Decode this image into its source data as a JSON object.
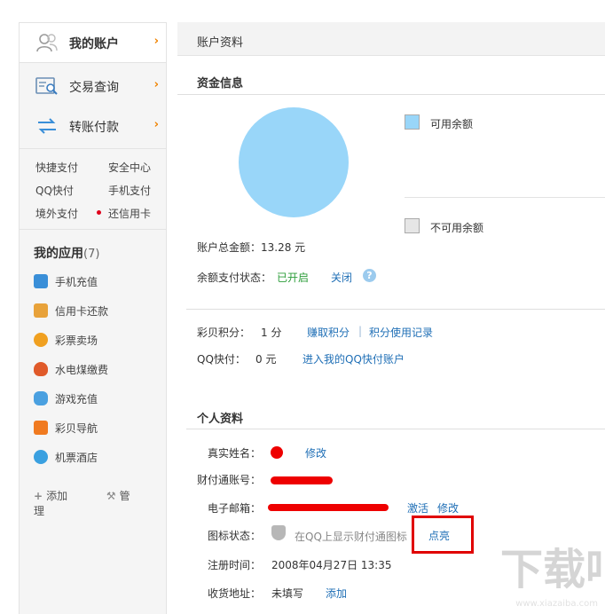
{
  "sidebar": {
    "nav": [
      {
        "label": "我的账户",
        "icon": "user-icon",
        "active": true
      },
      {
        "label": "交易查询",
        "icon": "search-list-icon",
        "active": false
      },
      {
        "label": "转账付款",
        "icon": "transfer-icon",
        "active": false
      }
    ],
    "chevron": "›",
    "quick_links": [
      "快捷支付",
      "安全中心",
      "QQ快付",
      "手机支付",
      "境外支付",
      "还信用卡"
    ],
    "apps_title": "我的应用",
    "apps_count": "(7)",
    "apps": [
      {
        "label": "手机充值",
        "icon": "phone-recharge-icon",
        "color": "#3a8fd8"
      },
      {
        "label": "信用卡还款",
        "icon": "credit-card-icon",
        "color": "#e8a23a"
      },
      {
        "label": "彩票卖场",
        "icon": "lottery-icon",
        "color": "#f0a020"
      },
      {
        "label": "水电煤缴费",
        "icon": "utility-flame-icon",
        "color": "#e05a2a"
      },
      {
        "label": "游戏充值",
        "icon": "gamepad-icon",
        "color": "#4aa0e0"
      },
      {
        "label": "彩贝导航",
        "icon": "caibei-nav-icon",
        "color": "#f07a20"
      },
      {
        "label": "机票酒店",
        "icon": "flight-hotel-icon",
        "color": "#3aa0e0"
      }
    ],
    "footer": {
      "add": "添加",
      "manage": "管理"
    }
  },
  "main": {
    "page_title": "账户资料",
    "funds": {
      "section_title": "资金信息",
      "legend": [
        {
          "label": "可用余额",
          "color": "#99d6f9"
        },
        {
          "label": "不可用余额",
          "color": "#e6e6e6"
        }
      ],
      "pie_color": "#99d6f9",
      "total_label": "账户总金额：",
      "total_value": "13.28 元",
      "pay_status_label": "余额支付状态：",
      "pay_status_value": "已开启",
      "pay_status_action": "关闭",
      "help": "?"
    },
    "points": {
      "caibei_label": "彩贝积分：",
      "caibei_value": "1 分",
      "earn_link": "赚取积分",
      "divider": "|",
      "record_link": "积分使用记录",
      "qq_label": "QQ快付：",
      "qq_value": "0 元",
      "qq_link": "进入我的QQ快付账户"
    },
    "profile": {
      "section_title": "个人资料",
      "real_name_label": "真实姓名：",
      "real_name_edit": "修改",
      "account_label": "财付通账号：",
      "email_label": "电子邮箱：",
      "email_activate": "激活",
      "email_edit": "修改",
      "icon_status_label": "图标状态：",
      "icon_status_text": "在QQ上显示财付通图标",
      "icon_status_action": "点亮",
      "reg_label": "注册时间：",
      "reg_value": "2008年04月27日  13:35",
      "address_label": "收货地址：",
      "address_value": "未填写",
      "address_add": "添加"
    }
  },
  "watermark": {
    "text": "www.xiazaiba.com"
  }
}
